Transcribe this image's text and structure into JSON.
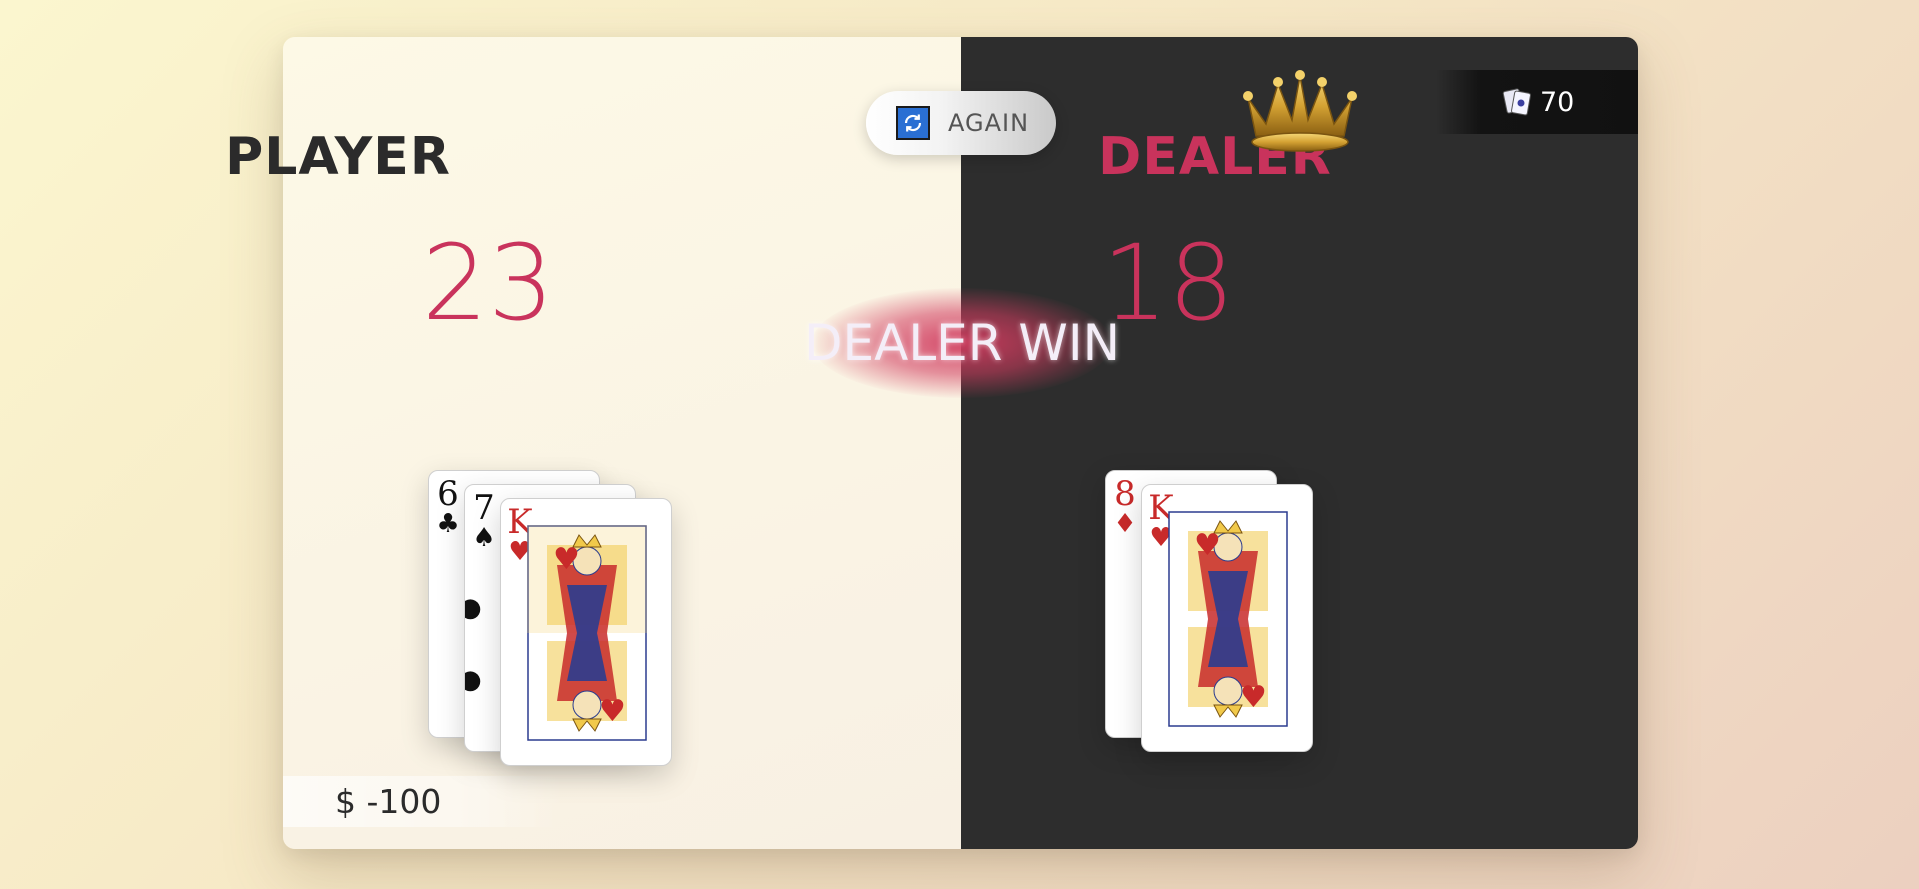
{
  "player": {
    "title": "PLAYER",
    "score": "23",
    "money": "$ -100",
    "cards": [
      {
        "rank": "6",
        "suit": "♣",
        "color": "black"
      },
      {
        "rank": "7",
        "suit": "♠",
        "color": "black"
      },
      {
        "rank": "K",
        "suit": "♥",
        "color": "red"
      }
    ]
  },
  "dealer": {
    "title": "DEALER",
    "score": "18",
    "cards": [
      {
        "rank": "8",
        "suit": "♦",
        "color": "red"
      },
      {
        "rank": "K",
        "suit": "♥",
        "color": "red"
      }
    ]
  },
  "controls": {
    "again_label": "AGAIN",
    "again_icon": "refresh-icon"
  },
  "deck": {
    "remaining": "70",
    "icon": "cards-deck-icon"
  },
  "result": {
    "text": "DEALER WIN"
  },
  "winner_icon": "crown-icon",
  "colors": {
    "accent": "#c9335c",
    "dealer_bg": "#2d2d2d",
    "player_bg": "#fdf9e6",
    "button_icon": "#2a6fd3"
  }
}
